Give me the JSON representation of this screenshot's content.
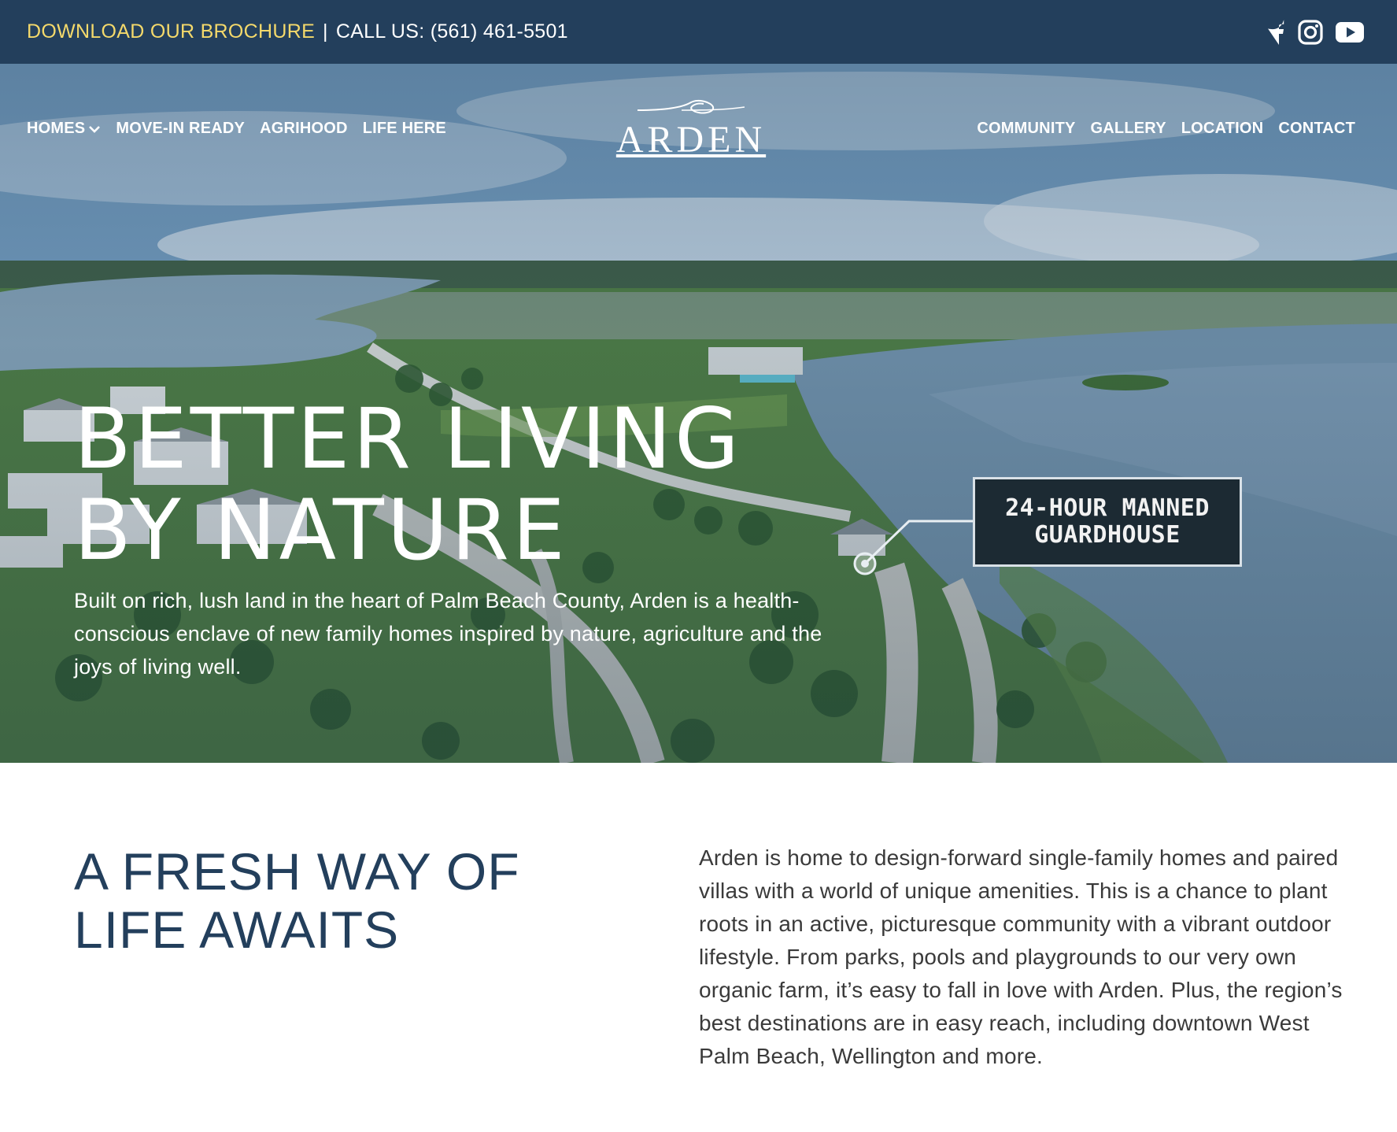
{
  "topbar": {
    "brochure_label": "DOWNLOAD OUR BROCHURE",
    "separator": "|",
    "call_label": "CALL US: (561) 461-5501",
    "social": [
      "facebook-icon",
      "instagram-icon",
      "youtube-icon"
    ],
    "accent_color": "#f4d96b",
    "background_color": "#233f5c"
  },
  "nav": {
    "left": [
      {
        "label": "HOMES",
        "has_dropdown": true
      },
      {
        "label": "MOVE-IN READY"
      },
      {
        "label": "AGRIHOOD"
      },
      {
        "label": "LIFE HERE"
      }
    ],
    "right": [
      {
        "label": "COMMUNITY"
      },
      {
        "label": "GALLERY"
      },
      {
        "label": "LOCATION"
      },
      {
        "label": "CONTACT"
      }
    ]
  },
  "logo": {
    "text": "ARDEN"
  },
  "hero": {
    "title_line1": "BETTER LIVING",
    "title_line2": "BY NATURE",
    "subtitle": "Built on rich, lush land in the heart of Palm Beach County, Arden is a health-conscious enclave of new family homes inspired by nature, agriculture and the joys of living well.",
    "callout_line1": "24-HOUR MANNED",
    "callout_line2": "GUARDHOUSE"
  },
  "intro": {
    "title_line1": "A FRESH WAY OF",
    "title_line2": "LIFE AWAITS",
    "body": "Arden is home to design-forward single-family homes and paired villas with a world of unique amenities. This is a chance to plant roots in an active, picturesque community with a vibrant outdoor lifestyle. From parks, pools and playgrounds to our very own organic farm, it’s easy to fall in love with Arden. Plus, the region’s best destinations are in easy reach, including downtown West Palm Beach, Wellington and more.",
    "title_color": "#233f5c"
  }
}
